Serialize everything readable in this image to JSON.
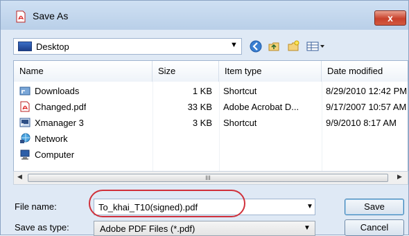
{
  "window": {
    "title": "Save As",
    "close_label": "x"
  },
  "address": {
    "location": "Desktop"
  },
  "columns": [
    "Name",
    "Size",
    "Item type",
    "Date modified"
  ],
  "files": [
    {
      "name": "Downloads",
      "size": "1 KB",
      "type": "Shortcut",
      "date": "8/29/2010 12:42 PM",
      "icon": "shortcut-folder-icon"
    },
    {
      "name": "Changed.pdf",
      "size": "33 KB",
      "type": "Adobe Acrobat D...",
      "date": "9/17/2007 10:57 AM",
      "icon": "pdf-file-icon"
    },
    {
      "name": "Xmanager 3",
      "size": "3 KB",
      "type": "Shortcut",
      "date": "9/9/2010 8:17 AM",
      "icon": "shortcut-app-icon"
    },
    {
      "name": "Network",
      "size": "",
      "type": "",
      "date": "",
      "icon": "network-icon"
    },
    {
      "name": "Computer",
      "size": "",
      "type": "",
      "date": "",
      "icon": "computer-icon"
    }
  ],
  "scroll": {
    "grip": "III"
  },
  "form": {
    "file_name_label": "File name:",
    "file_name_value": "To_khai_T10(signed).pdf",
    "save_type_label": "Save as type:",
    "save_type_value": "Adobe PDF Files (*.pdf)"
  },
  "buttons": {
    "save": "Save",
    "cancel": "Cancel"
  }
}
